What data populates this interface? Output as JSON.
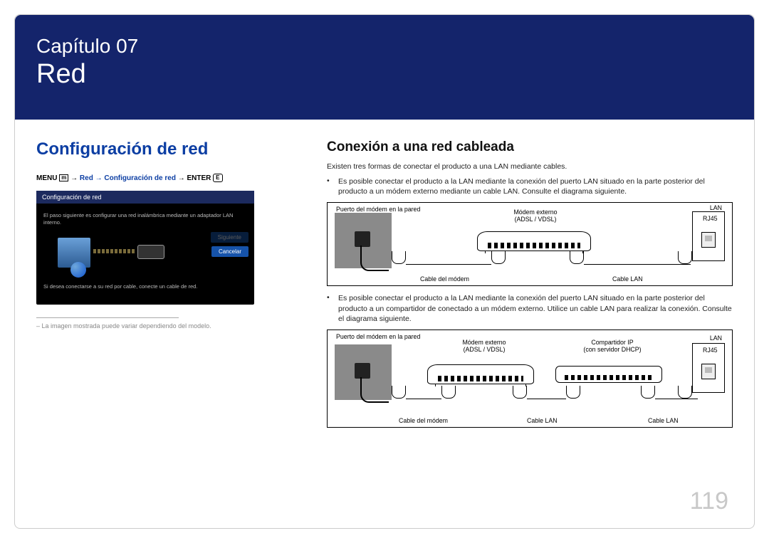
{
  "chapter": {
    "label": "Capítulo 07",
    "title": "Red"
  },
  "left": {
    "section_title": "Configuración de red",
    "menu_path": {
      "prefix": "MENU",
      "icon_m": "m",
      "arrow": " → ",
      "highlight": "Red → Configuración de red",
      "suffix": " → ENTER",
      "icon_e": "E"
    },
    "screenshot": {
      "titlebar": "Configuración de red",
      "line1": "El paso siguiente es configurar una red inalámbrica mediante un adaptador LAN interno.",
      "line2": "Si desea conectarse a su red por cable, conecte un cable de red.",
      "btn_next": "Siguiente",
      "btn_cancel": "Cancelar"
    },
    "footnote": "La imagen mostrada puede variar dependiendo del modelo."
  },
  "right": {
    "section_title": "Conexión a una red cableada",
    "intro": "Existen tres formas de conectar el producto a una LAN mediante cables.",
    "bullet1": "Es posible conectar el producto a la LAN mediante la conexión del puerto LAN situado en la parte posterior del producto a un módem externo mediante un cable LAN. Consulte el diagrama siguiente.",
    "bullet2": "Es posible conectar el producto a la LAN mediante la conexión del puerto LAN situado en la parte posterior del producto a un compartidor de conectado a un módem externo. Utilice un cable LAN para realizar la conexión. Consulte el diagrama siguiente.",
    "diagram_labels": {
      "wall": "Puerto del módem en la pared",
      "modem": "Módem externo",
      "modem_sub": "(ADSL / VDSL)",
      "sharer": "Compartidor IP",
      "sharer_sub": "(con servidor DHCP)",
      "cable_modem": "Cable del módem",
      "cable_lan": "Cable LAN",
      "lan": "LAN",
      "rj45": "RJ45"
    }
  },
  "page_number": "119"
}
